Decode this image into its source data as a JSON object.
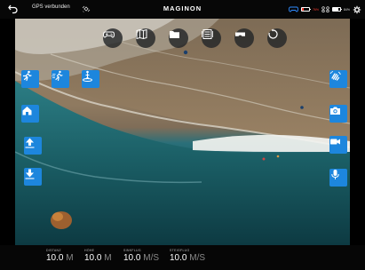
{
  "status_bar": {
    "gps_text": "GPS verbunden",
    "brand": "MAGINON",
    "remote_battery_pct": "76%",
    "drone_battery_pct": "84%"
  },
  "toolbar": {
    "buttons": [
      {
        "icon": "gamepad-icon"
      },
      {
        "icon": "map-icon"
      },
      {
        "icon": "folder-icon"
      },
      {
        "icon": "gallery-icon"
      },
      {
        "icon": "vr-glasses-icon"
      },
      {
        "icon": "restart-icon"
      }
    ]
  },
  "left_controls": [
    {
      "icon": "running-person-icon"
    },
    {
      "icon": "fast-running-icon"
    },
    {
      "icon": "landing-person-icon"
    },
    {
      "icon": "home-icon"
    },
    {
      "icon": "takeoff-up-icon"
    },
    {
      "icon": "land-down-icon"
    }
  ],
  "right_controls": [
    {
      "icon": "wave-hand-icon"
    },
    {
      "icon": "camera-icon"
    },
    {
      "icon": "video-camera-icon"
    },
    {
      "icon": "microphone-icon"
    }
  ],
  "telemetry": [
    {
      "label": "DISTANZ",
      "value": "10.0",
      "unit": "M"
    },
    {
      "label": "HÖHE",
      "value": "10.0",
      "unit": "M"
    },
    {
      "label": "SINKFLUG",
      "value": "10.0",
      "unit": "M/S"
    },
    {
      "label": "STEIGFLUG",
      "value": "10.0",
      "unit": "M/S"
    }
  ]
}
